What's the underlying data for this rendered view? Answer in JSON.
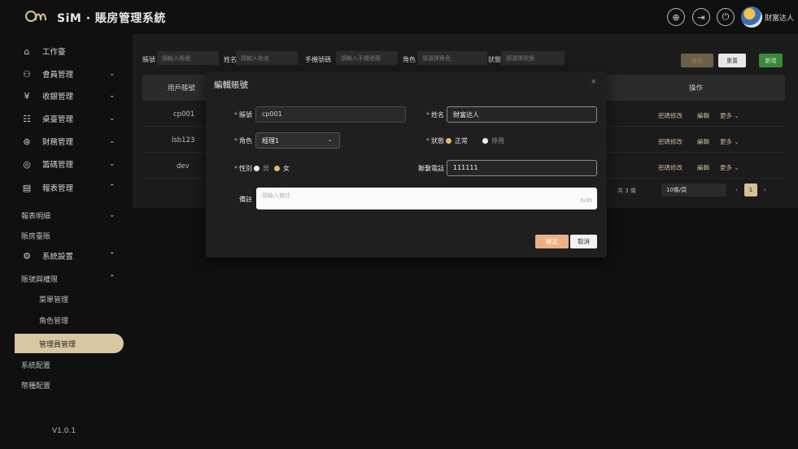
{
  "header": {
    "brand": "SiM · 賬房管理系統",
    "username": "財富达人",
    "icons": [
      "globe-icon",
      "logout-icon",
      "power-icon"
    ]
  },
  "sidebar": {
    "items": [
      {
        "label": "工作臺",
        "icon": "home-icon",
        "chevron": ""
      },
      {
        "label": "會員管理",
        "icon": "users-icon",
        "chevron": "⌄"
      },
      {
        "label": "收銀管理",
        "icon": "yen-icon",
        "chevron": "⌄"
      },
      {
        "label": "桌臺管理",
        "icon": "table-icon",
        "chevron": "⌄"
      },
      {
        "label": "財務管理",
        "icon": "money-icon",
        "chevron": "⌄"
      },
      {
        "label": "籌碼管理",
        "icon": "chip-icon",
        "chevron": "⌄"
      },
      {
        "label": "報表管理",
        "icon": "report-icon",
        "chevron": "⌃"
      }
    ],
    "sub_items_report": [
      {
        "label": "報表明細",
        "chevron": "⌄"
      },
      {
        "label": "賬房臺賬",
        "chevron": ""
      }
    ],
    "settings": {
      "label": "系統設置",
      "icon": "gear-icon",
      "chevron": "⌃"
    },
    "account_perm": {
      "label": "賬號與權限",
      "chevron": "⌃"
    },
    "account_sub": [
      "菜單管理",
      "角色管理",
      "管理員管理"
    ],
    "other": [
      "系統配置",
      "幣種配置"
    ],
    "version": "V1.0.1"
  },
  "filters": {
    "account_label": "賬號",
    "account_placeholder": "請輸入賬號",
    "name_label": "姓名",
    "name_placeholder": "請輸入姓名",
    "phone_label": "手機號碼",
    "phone_placeholder": "請輸入手機號碼",
    "role_label": "角色",
    "role_placeholder": "請選擇角色",
    "status_label": "狀態",
    "status_placeholder": "請選擇狀態",
    "btn_search": "搜索",
    "btn_reset": "重置",
    "btn_add": "新增"
  },
  "table": {
    "headers": {
      "account": "用戶賬號",
      "ops": "操作"
    },
    "rows": [
      {
        "account": "cp001"
      },
      {
        "account": "lsb123"
      },
      {
        "account": "dev"
      }
    ],
    "ops": {
      "pwd": "密碼修改",
      "edit": "編輯",
      "more": "更多 ⌄"
    },
    "pager": {
      "total": "共 3 條",
      "size": "10條/頁",
      "page": "1"
    }
  },
  "modal": {
    "title": "編輯賬號",
    "close": "×",
    "account_label": "賬號",
    "account_value": "cp001",
    "name_label": "姓名",
    "name_value": "財富达人",
    "role_label": "角色",
    "role_value": "經理1",
    "status_label": "狀態",
    "status_on": "正常",
    "status_off": "停用",
    "gender_label": "性別",
    "gender_male": "男",
    "gender_female": "女",
    "phone_label": "聯繫電話",
    "phone_value": "111111",
    "remark_label": "備註",
    "remark_placeholder": "請輸入備註",
    "remark_counter": "0/30",
    "btn_ok": "確定",
    "btn_cancel": "取消"
  }
}
